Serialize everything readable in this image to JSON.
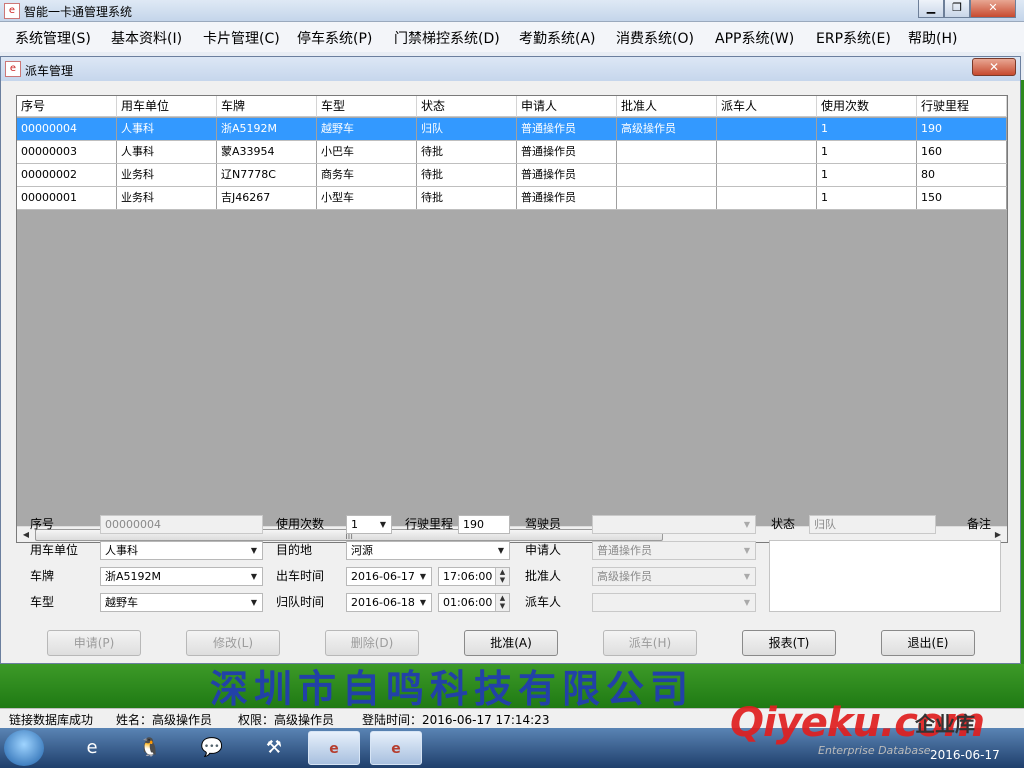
{
  "window": {
    "title": "智能一卡通管理系统",
    "controls": [
      "minimize",
      "maximize",
      "close"
    ]
  },
  "menu": [
    "系统管理(S)",
    "基本资料(I)",
    "卡片管理(C)",
    "停车系统(P)",
    "门禁梯控系统(D)",
    "考勤系统(A)",
    "消费系统(O)",
    "APP系统(W)",
    "ERP系统(E)",
    "帮助(H)"
  ],
  "dialog": {
    "title": "派车管理",
    "icon": "app-logo-icon",
    "close_symbol": "✕"
  },
  "grid": {
    "columns": [
      "序号",
      "用车单位",
      "车牌",
      "车型",
      "状态",
      "申请人",
      "批准人",
      "派车人",
      "使用次数",
      "行驶里程"
    ],
    "rows": [
      [
        "00000004",
        "人事科",
        "浙A5192M",
        "越野车",
        "归队",
        "普通操作员",
        "高级操作员",
        "",
        "1",
        "190"
      ],
      [
        "00000003",
        "人事科",
        "蒙A33954",
        "小巴车",
        "待批",
        "普通操作员",
        "",
        "",
        "1",
        "160"
      ],
      [
        "00000002",
        "业务科",
        "辽N7778C",
        "商务车",
        "待批",
        "普通操作员",
        "",
        "",
        "1",
        "80"
      ],
      [
        "00000001",
        "业务科",
        "吉J46267",
        "小型车",
        "待批",
        "普通操作员",
        "",
        "",
        "1",
        "150"
      ]
    ],
    "selected_row": 0
  },
  "form": {
    "seq_label": "序号",
    "seq_value": "00000004",
    "count_label": "使用次数",
    "count_value": "1",
    "mileage_label": "行驶里程",
    "mileage_value": "190",
    "driver_label": "驾驶员",
    "driver_value": "",
    "status_label": "状态",
    "status_value": "归队",
    "remark_label": "备注",
    "unit_label": "用车单位",
    "unit_value": "人事科",
    "dest_label": "目的地",
    "dest_value": "河源",
    "applicant_label": "申请人",
    "applicant_value": "普通操作员",
    "plate_label": "车牌",
    "plate_value": "浙A5192M",
    "out_label": "出车时间",
    "out_date": "2016-06-17",
    "out_time": "17:06:00",
    "approver_label": "批准人",
    "approver_value": "高级操作员",
    "type_label": "车型",
    "type_value": "越野车",
    "return_label": "归队时间",
    "return_date": "2016-06-18",
    "return_time": "01:06:00",
    "dispatcher_label": "派车人",
    "dispatcher_value": ""
  },
  "buttons": {
    "apply": "申请(P)",
    "modify": "修改(L)",
    "delete": "删除(D)",
    "approve": "批准(A)",
    "dispatch": "派车(H)",
    "report": "报表(T)",
    "exit": "退出(E)"
  },
  "banner": {
    "text": "深圳市自鸣科技有限公司"
  },
  "status": {
    "db": "链接数据库成功",
    "user": "姓名：高级操作员",
    "role": "权限：高级操作员",
    "login": "登陆时间：2016-06-17 17:14:23"
  },
  "watermark": {
    "brand": "Qiyeku.com",
    "cn": "企业库",
    "en": "Enterprise Database"
  },
  "taskbar": {
    "apps": [
      "ie-icon",
      "qq-icon",
      "wechat-icon",
      "tools-icon",
      "app-window-1",
      "app-window-2"
    ],
    "clock_date": "2016-06-17"
  },
  "colors": {
    "selection": "#3399ff",
    "banner": "#2d8a1e",
    "banner_text": "#2241a8",
    "watermark": "#e01f1f"
  }
}
